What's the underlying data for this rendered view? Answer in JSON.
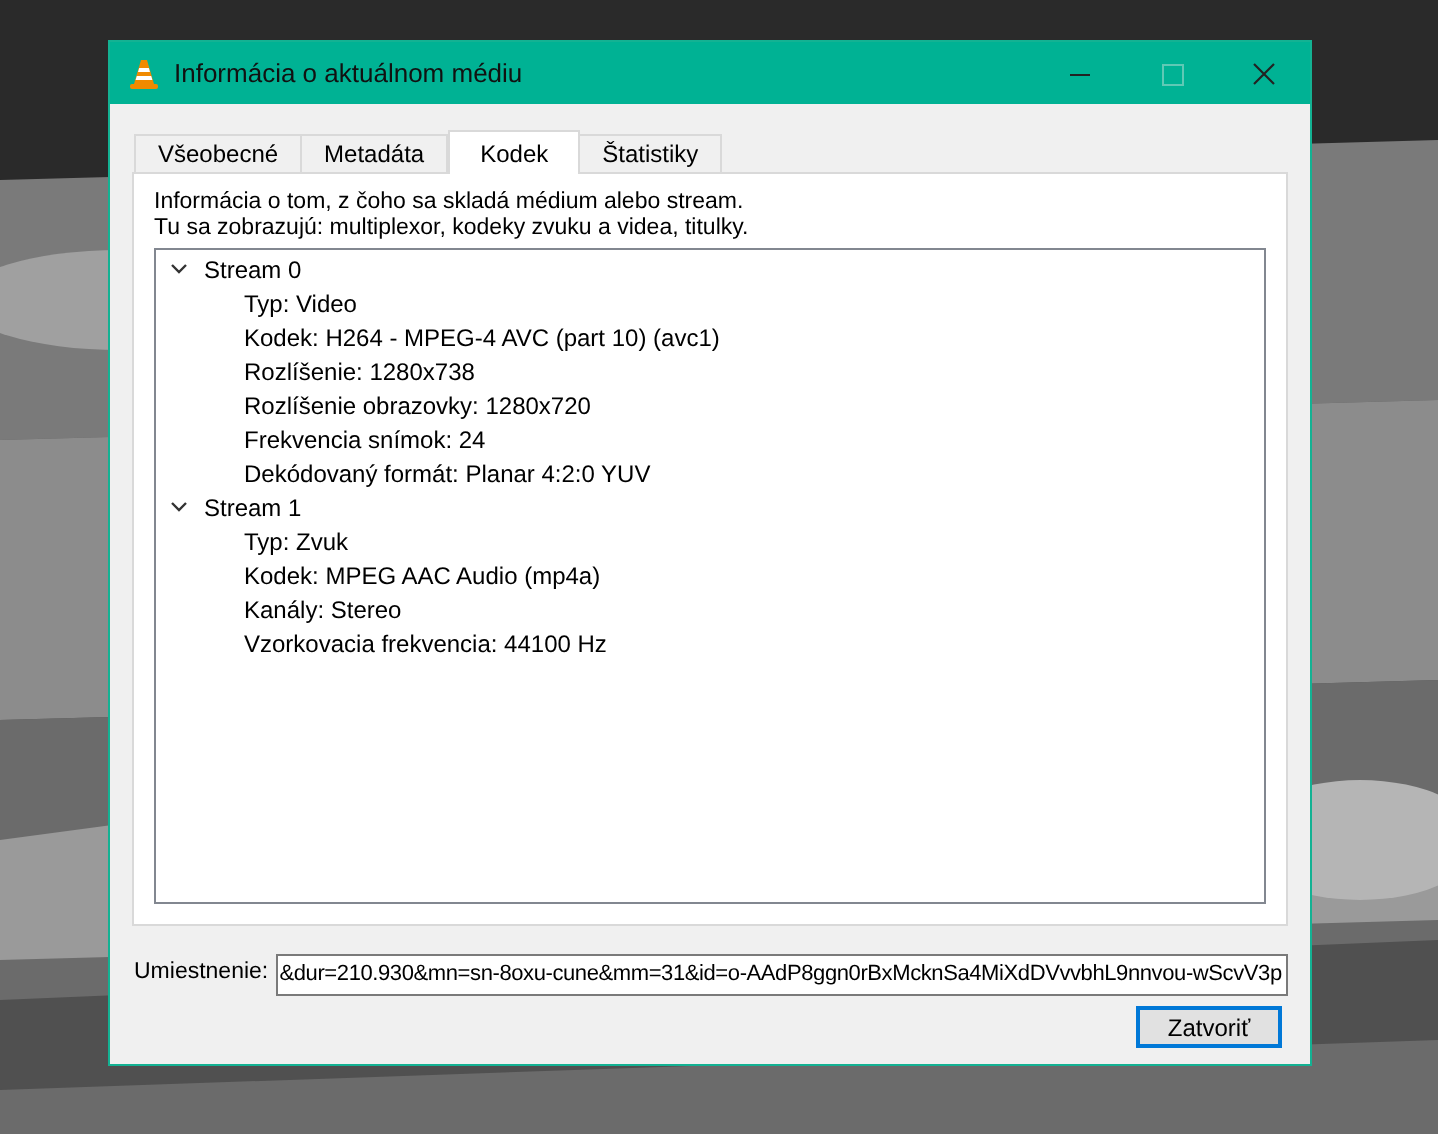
{
  "window": {
    "title": "Informácia o aktuálnom médiu"
  },
  "tabs": [
    {
      "label": "Všeobecné",
      "selected": false
    },
    {
      "label": "Metadáta",
      "selected": false
    },
    {
      "label": "Kodek",
      "selected": true
    },
    {
      "label": "Štatistiky",
      "selected": false
    }
  ],
  "description": [
    "Informácia o tom, z čoho sa skladá médium alebo stream.",
    "Tu sa zobrazujú: multiplexor, kodeky zvuku a videa, titulky."
  ],
  "streams": [
    {
      "label": "Stream 0",
      "expanded": true,
      "children": [
        {
          "label": "Typ: Video"
        },
        {
          "label": "Kodek: H264 - MPEG-4 AVC (part 10) (avc1)"
        },
        {
          "label": "Rozlíšenie: 1280x738"
        },
        {
          "label": "Rozlíšenie obrazovky: 1280x720"
        },
        {
          "label": "Frekvencia snímok: 24"
        },
        {
          "label": "Dekódovaný formát: Planar 4:2:0 YUV"
        }
      ]
    },
    {
      "label": "Stream 1",
      "expanded": true,
      "children": [
        {
          "label": "Typ: Zvuk"
        },
        {
          "label": "Kodek: MPEG AAC Audio (mp4a)"
        },
        {
          "label": "Kanály: Stereo"
        },
        {
          "label": "Vzorkovacia frekvencia: 44100 Hz"
        }
      ]
    }
  ],
  "location": {
    "label": "Umiestnenie:",
    "value": "&dur=210.930&mn=sn-8oxu-cune&mm=31&id=o-AAdP8ggn0rBxMcknSa4MiXdDVvvbhL9nnvou-wScvV3p"
  },
  "buttons": [
    "Zatvoriť"
  ]
}
